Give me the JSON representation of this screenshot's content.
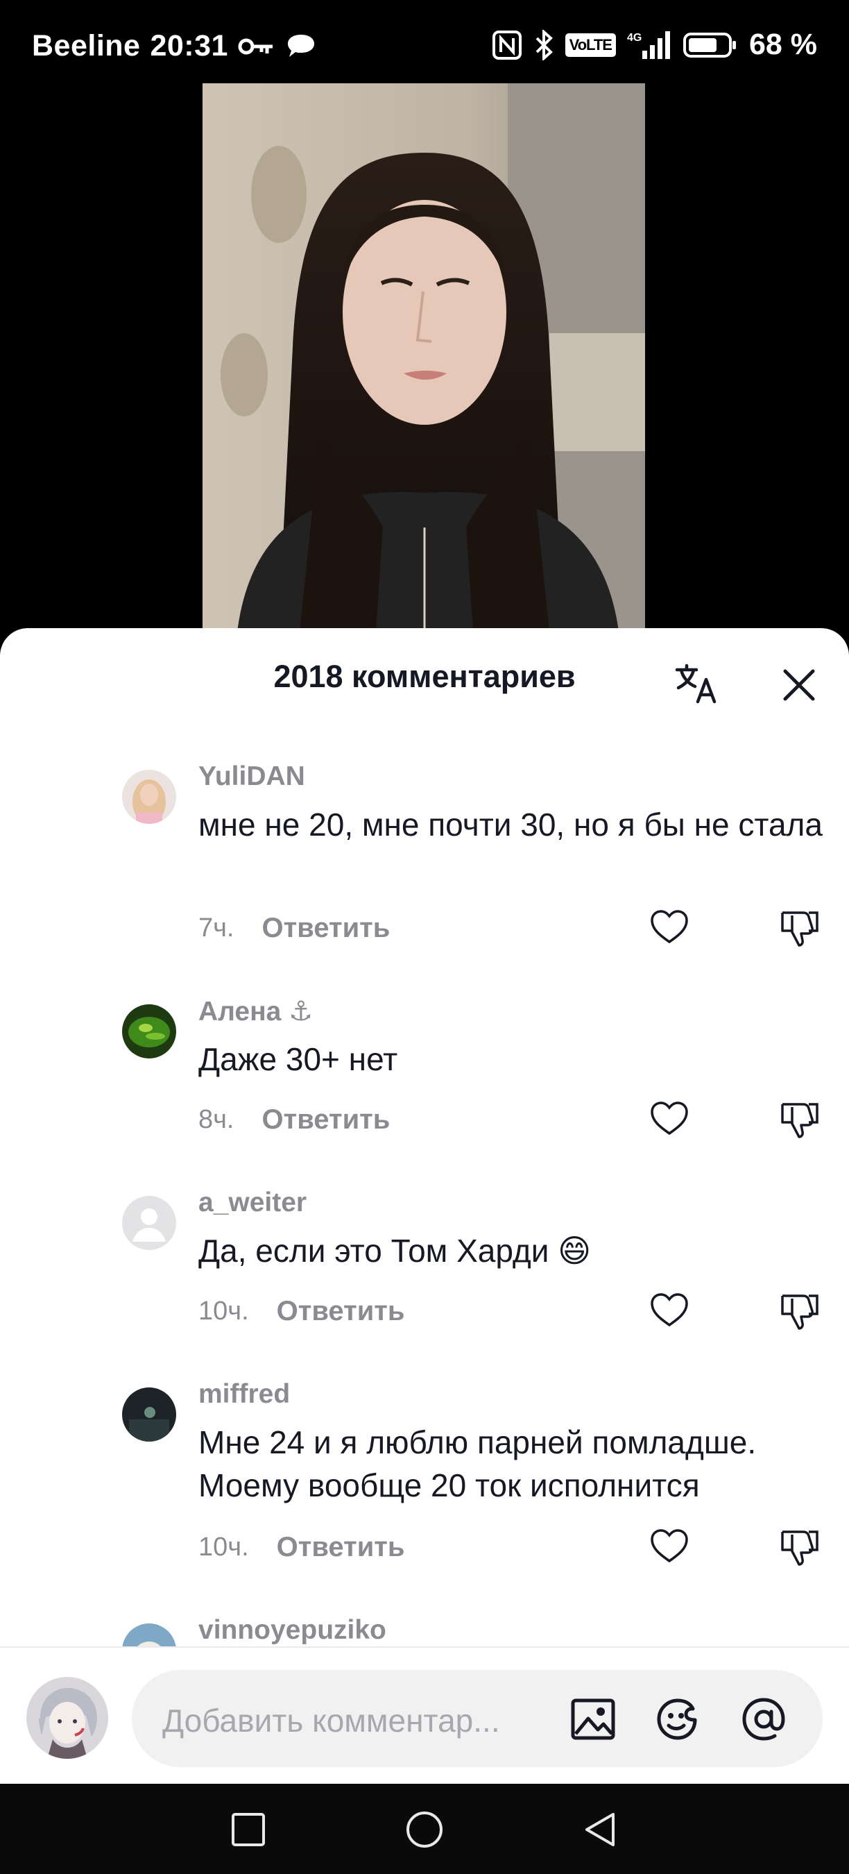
{
  "status_bar": {
    "carrier": "Beeline",
    "time": "20:31",
    "volte": "VoLTE",
    "network": "4G",
    "battery": "68 %"
  },
  "sheet": {
    "title": "2018 комментариев"
  },
  "comments": [
    {
      "user": "YuliDAN",
      "text": "мне не 20, мне почти 30, но я бы не стала",
      "time": "7ч.",
      "reply": "Ответить"
    },
    {
      "user": "Алена ⚓",
      "text": "Даже 30+ нет",
      "time": "8ч.",
      "reply": "Ответить"
    },
    {
      "user": "a_weiter",
      "text": "Да, если это Том Харди 😄",
      "time": "10ч.",
      "reply": "Ответить"
    },
    {
      "user": "miffred",
      "text": "Мне 24 и я люблю парней помладше. Моему вообще 20 ток исполнится",
      "time": "10ч.",
      "reply": "Ответить"
    },
    {
      "user": "vinnoyepuziko"
    }
  ],
  "input": {
    "placeholder": "Добавить комментар..."
  },
  "colors": {
    "text_primary": "#161823",
    "text_secondary": "#8a8b91",
    "sheet_bg": "#ffffff",
    "input_bg": "#f1f1f2"
  }
}
